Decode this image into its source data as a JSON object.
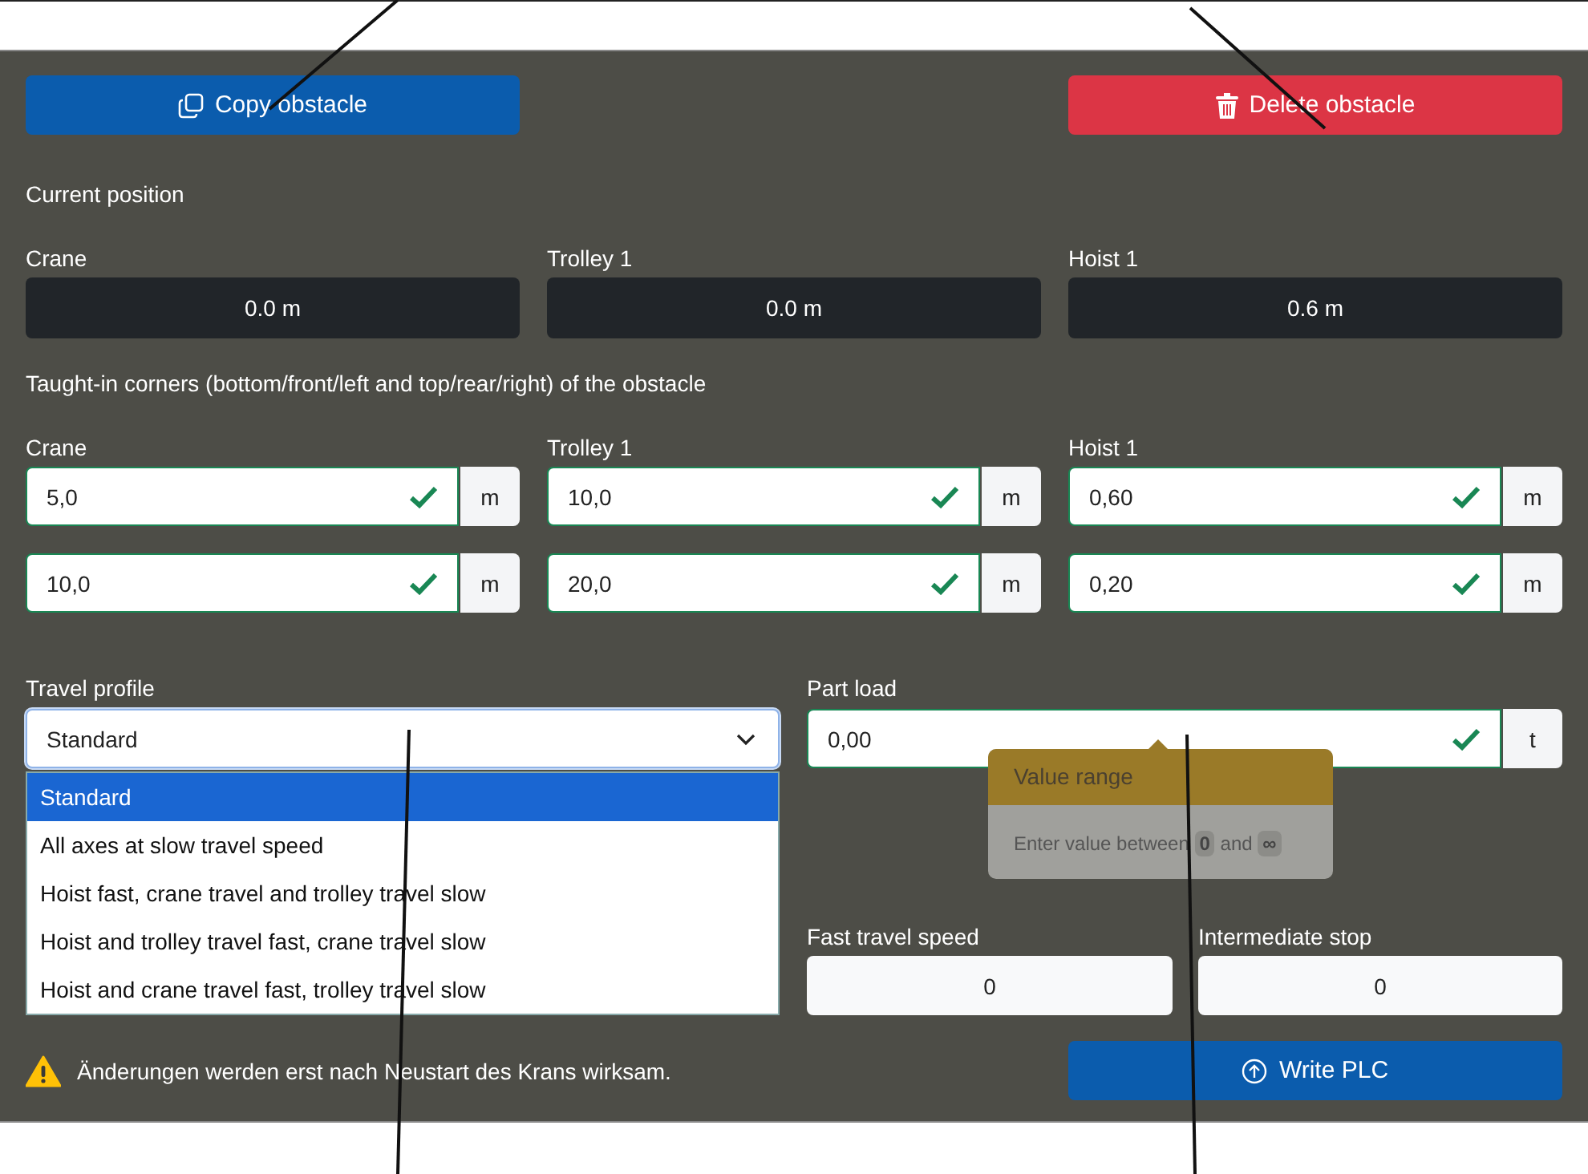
{
  "actions": [
    {
      "kind": "copy",
      "label": "Copy obstacle"
    },
    {
      "kind": "delete",
      "label": "Delete obstacle"
    }
  ],
  "current_position": {
    "title": "Current position",
    "axes": [
      {
        "label": "Crane",
        "value": "0.0 m"
      },
      {
        "label": "Trolley 1",
        "value": "0.0 m"
      },
      {
        "label": "Hoist 1",
        "value": "0.6 m"
      }
    ]
  },
  "corners": {
    "title": "Taught-in corners (bottom/front/left and top/rear/right) of the obstacle",
    "axes": [
      {
        "label": "Crane",
        "values": [
          {
            "value": "5,0",
            "valid": true,
            "unit": "m"
          },
          {
            "value": "10,0",
            "valid": true,
            "unit": "m"
          }
        ]
      },
      {
        "label": "Trolley 1",
        "values": [
          {
            "value": "10,0",
            "valid": true,
            "unit": "m"
          },
          {
            "value": "20,0",
            "valid": true,
            "unit": "m"
          }
        ]
      },
      {
        "label": "Hoist 1",
        "values": [
          {
            "value": "0,60",
            "valid": true,
            "unit": "m"
          },
          {
            "value": "0,20",
            "valid": true,
            "unit": "m"
          }
        ]
      }
    ]
  },
  "travel_profile": {
    "label": "Travel profile",
    "value": "Standard",
    "expanded": true,
    "options": [
      {
        "label": "Standard",
        "selected": true
      },
      {
        "label": "All axes at slow travel speed",
        "selected": false
      },
      {
        "label": "Hoist fast, crane travel and trolley travel slow",
        "selected": false
      },
      {
        "label": "Hoist and trolley travel fast, crane travel slow",
        "selected": false
      },
      {
        "label": "Hoist and crane travel fast, trolley travel slow",
        "selected": false
      }
    ]
  },
  "part_load": {
    "label": "Part load",
    "value": "0,00",
    "valid": true,
    "unit": "t",
    "tooltip": {
      "title": "Value range",
      "text": "Enter value between",
      "min": "0",
      "conj": "and",
      "max": "∞"
    }
  },
  "speeds": [
    {
      "label": "Fast travel speed",
      "value": "0"
    },
    {
      "label": "Intermediate stop",
      "value": "0"
    }
  ],
  "notice": {
    "text": "Änderungen werden erst nach Neustart des Krans wirksam."
  },
  "write_button": {
    "label": "Write PLC"
  }
}
